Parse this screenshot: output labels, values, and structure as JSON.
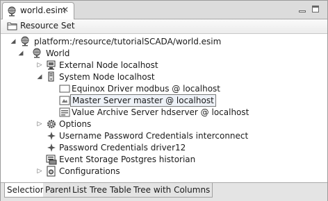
{
  "editor": {
    "tab_label": "world.esim",
    "close_glyph": "✕"
  },
  "header": {
    "title": "Resource Set"
  },
  "tree": {
    "root": "platform:/resource/tutorialSCADA/world.esim",
    "world": "World",
    "external_node": "External Node localhost",
    "system_node": "System Node localhost",
    "equinox_driver": "Equinox Driver modbus @ localhost",
    "master_server": "Master Server master @ localhost",
    "value_archive": "Value Archive Server hdserver @ localhost",
    "options": "Options",
    "username_credentials": "Username Password Credentials interconnect",
    "password_credentials": "Password Credentials driver12",
    "event_storage": "Event Storage Postgres historian",
    "configurations": "Configurations"
  },
  "bottom_tabs": [
    "Selection",
    "Parent",
    "List",
    "Tree",
    "Table",
    "Tree with Columns"
  ],
  "colors": {
    "selection_border": "#7a7a7a",
    "tab_bar": "#dcdcdc"
  }
}
